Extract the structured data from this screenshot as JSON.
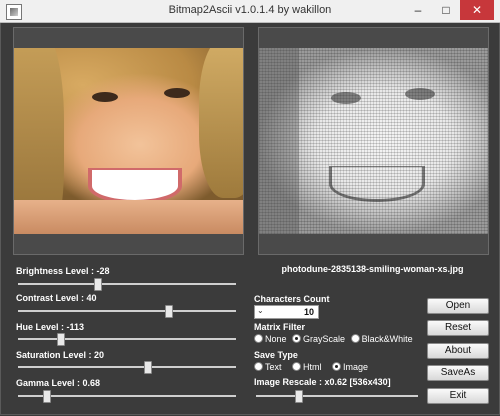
{
  "window": {
    "title": "Bitmap2Ascii v1.0.1.4 by wakillon",
    "controls": {
      "minimize": "–",
      "maximize": "□",
      "close": "✕"
    }
  },
  "preview": {
    "filename": "photodune-2835138-smiling-woman-xs.jpg"
  },
  "sliders": {
    "brightness": {
      "label": "Brightness Level : -28",
      "value": -28,
      "min": -100,
      "max": 100
    },
    "contrast": {
      "label": "Contrast Level : 40",
      "value": 40,
      "min": -100,
      "max": 100
    },
    "hue": {
      "label": "Hue Level : -113",
      "value": -113,
      "min": -180,
      "max": 180
    },
    "saturation": {
      "label": "Saturation Level : 20",
      "value": 20,
      "min": -100,
      "max": 100
    },
    "gamma": {
      "label": "Gamma Level : 0.68",
      "value": 0.68,
      "min": 0.1,
      "max": 5
    }
  },
  "characters_count": {
    "label": "Characters Count",
    "value": "10",
    "arrow": "⌄"
  },
  "matrix_filter": {
    "label": "Matrix Filter",
    "options": [
      "None",
      "GrayScale",
      "Black&White"
    ],
    "selected": "GrayScale"
  },
  "save_type": {
    "label": "Save Type",
    "options": [
      "Text",
      "Html",
      "Image"
    ],
    "selected": "Image"
  },
  "image_rescale": {
    "label": "Image Rescale : x0.62 [536x430]",
    "value": 0.62
  },
  "buttons": {
    "open": "Open",
    "reset": "Reset",
    "about": "About",
    "saveas": "SaveAs",
    "exit": "Exit"
  },
  "colors": {
    "background": "#3b3b3b",
    "panel": "#5a5a5a",
    "close_button": "#c7373b"
  }
}
